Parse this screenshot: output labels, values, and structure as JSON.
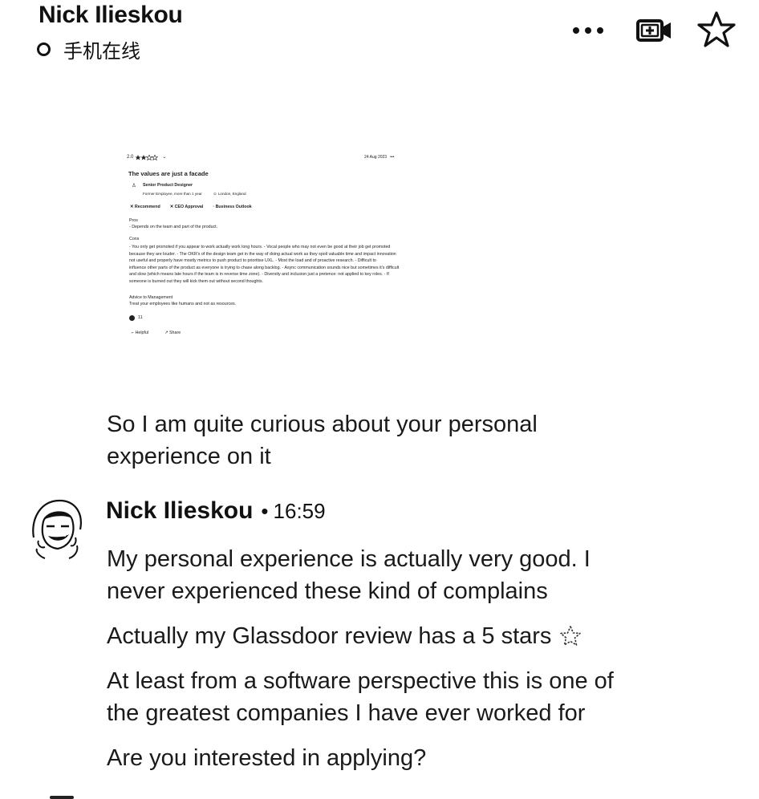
{
  "header": {
    "contact_name": "Nick Ilieskou",
    "status_text": "手机在线",
    "icons": {
      "more": "more-horizontal-icon",
      "video": "video-call-icon",
      "favorite": "star-icon"
    }
  },
  "shared_image": {
    "rating_value": "2.0",
    "date_text": "24 Aug 2023",
    "title": "The values are just a facade",
    "job_title": "Senior Product Designer",
    "employment": "Former Employee, more than 1 year",
    "location": "London, England",
    "badges": [
      "Recommend",
      "CEO Approval",
      "Business Outlook"
    ],
    "pros_heading": "Pros",
    "pros_text": "- Depends on the team and part of the product.",
    "cons_heading": "Cons",
    "cons_lines": [
      "- You only get promoted if you appear to work actually work long hours. - Vocal people who may not even be good at their job get promoted",
      "because they are louder. - The OKR's of the design team get in the way of doing actual work as they spoil valuable time and impact innovation",
      "not useful and properly have mostly metrics to push product to prioritise UXL. - Most the load and of proactive research. - Difficult to",
      "influence other parts of the product as everyone is trying to chase along backlog. - Async communication sounds nice but sometimes it's difficult",
      "and slow (which means late hours if the team is in reverse time zone). - Diversity and inclusion just a pretence: not applied to key roles. - If",
      "someone is burned out they will kick them out without second thoughts."
    ],
    "advice_heading": "Advice to Management",
    "advice_text": "Treat your employees like humans and not as resources.",
    "reaction_count": "11",
    "actions": [
      "Helpful",
      "Share"
    ]
  },
  "messages": {
    "prev_lines": [
      "So I am quite curious about your personal",
      "experience on it"
    ],
    "sender": "Nick Ilieskou",
    "separator": "•",
    "time": "16:59",
    "m1_lines": [
      "My personal experience is actually very good. I",
      "never experienced these kind of complains"
    ],
    "m2_text": "Actually my Glassdoor review has a 5 stars",
    "m2_emoji": "sparkle-star-icon",
    "m3_lines": [
      "At least from a software perspective this is one of",
      "the greatest companies I have ever worked for"
    ],
    "m4_text": "Are you interested in applying?"
  }
}
